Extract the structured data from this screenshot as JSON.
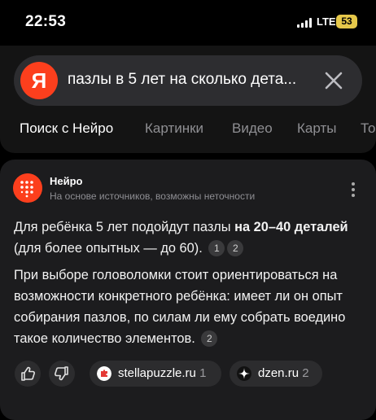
{
  "status_bar": {
    "time": "22:53",
    "network": "LTE",
    "battery": "53"
  },
  "search": {
    "logo": "Я",
    "query": "пазлы в 5 лет на сколько дета..."
  },
  "tabs": [
    "Поиск с Нейро",
    "Картинки",
    "Видео",
    "Карты",
    "То"
  ],
  "answer": {
    "title": "Нейро",
    "subtitle": "На основе источников, возможны неточности",
    "p1_pre": "Для ребёнка 5 лет подойдут пазлы ",
    "p1_bold": "на 20–40 деталей",
    "p1_post": " (для более опытных — до 60).",
    "p1_refs": [
      "1",
      "2"
    ],
    "p2_text": "При выборе головоломки стоит ориентироваться на возможности конкретного ребёнка: имеет ли он опыт собирания пазлов, по силам ли ему собрать воедино такое количество элементов.",
    "p2_ref": "2",
    "sources": [
      {
        "name": "stellapuzzle.ru",
        "num": "1"
      },
      {
        "name": "dzen.ru",
        "num": "2"
      }
    ]
  },
  "icons": [
    "signal-icon",
    "yandex-logo-icon",
    "clear-icon",
    "neuro-logo-icon",
    "more-icon",
    "thumbs-up-icon",
    "thumbs-down-icon",
    "stellapuzzle-favicon-icon",
    "dzen-favicon-icon"
  ],
  "colors": {
    "accent": "#fc3f1d",
    "battery": "#e6c84a",
    "background": "#000000",
    "card": "#1c1c1e"
  }
}
